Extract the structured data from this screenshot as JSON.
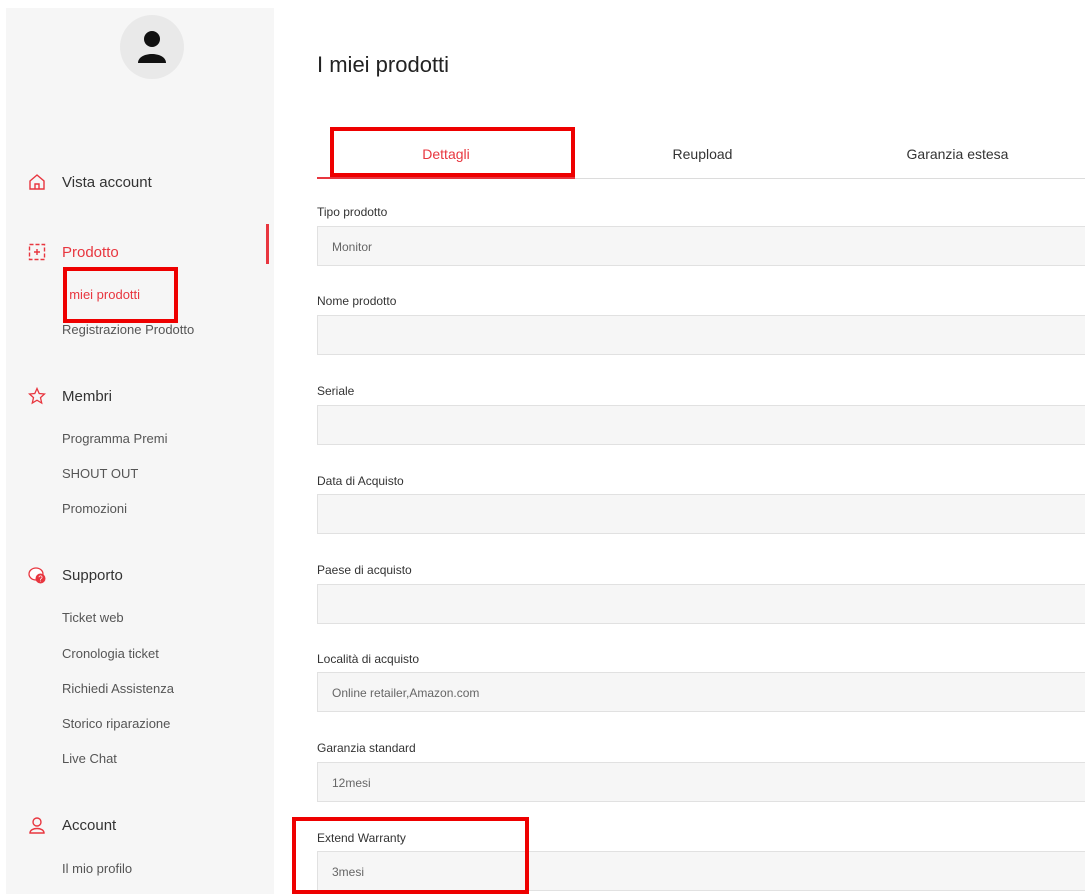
{
  "sidebar": {
    "sections": [
      {
        "label": "Vista account",
        "icon": "home-icon"
      },
      {
        "label": "Prodotto",
        "icon": "product-icon"
      },
      {
        "label": "Membri",
        "icon": "star-icon"
      },
      {
        "label": "Supporto",
        "icon": "support-chat-icon"
      },
      {
        "label": "Account",
        "icon": "user-icon"
      }
    ],
    "prodotto_items": [
      "I miei prodotti",
      "Registrazione Prodotto"
    ],
    "membri_items": [
      "Programma Premi",
      "SHOUT OUT",
      "Promozioni"
    ],
    "supporto_items": [
      "Ticket web",
      "Cronologia ticket",
      "Richiedi Assistenza",
      "Storico riparazione",
      "Live Chat"
    ],
    "account_items": [
      "Il mio profilo"
    ],
    "support_badge": "?"
  },
  "main": {
    "title": "I miei prodotti",
    "tabs": [
      "Dettagli",
      "Reupload",
      "Garanzia estesa"
    ],
    "fields": [
      {
        "label": "Tipo prodotto",
        "value": "Monitor"
      },
      {
        "label": "Nome prodotto",
        "value": ""
      },
      {
        "label": "Seriale",
        "value": ""
      },
      {
        "label": "Data di Acquisto",
        "value": ""
      },
      {
        "label": "Paese di acquisto",
        "value": ""
      },
      {
        "label": "Località di acquisto",
        "value": "Online retailer,Amazon.com"
      },
      {
        "label": "Garanzia standard",
        "value": "12mesi"
      },
      {
        "label": "Extend Warranty",
        "value": "3mesi"
      }
    ]
  },
  "colors": {
    "accent": "#e8363f",
    "highlight": "#ee0000"
  }
}
